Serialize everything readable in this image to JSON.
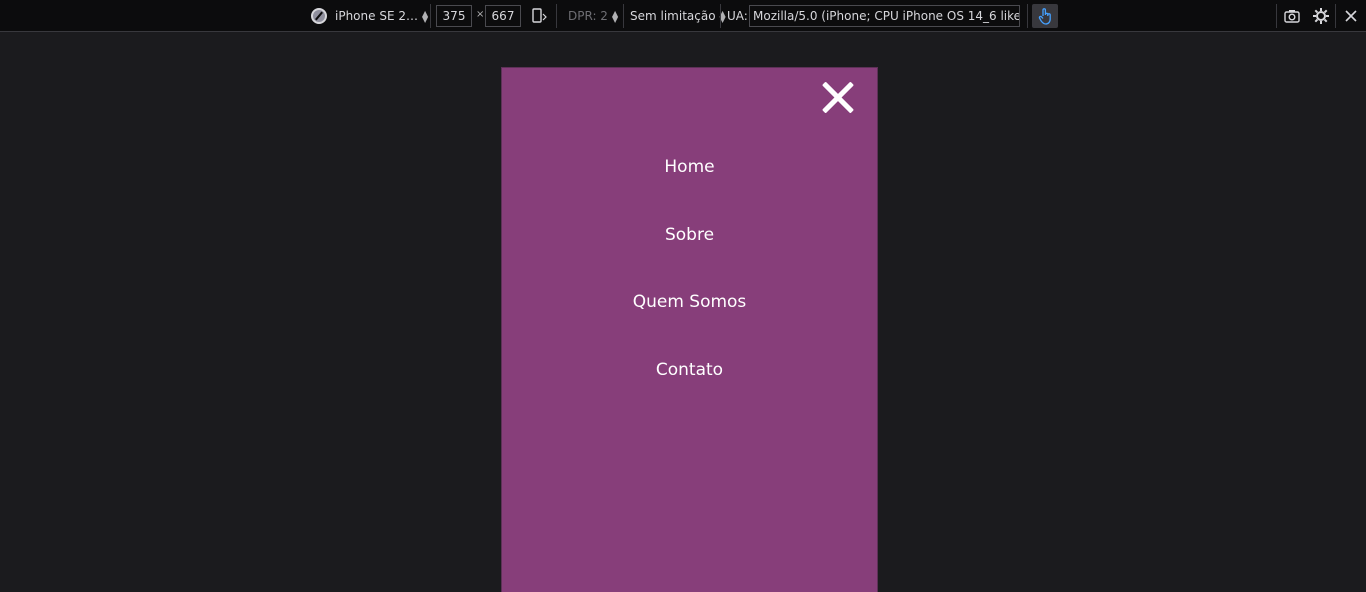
{
  "toolbar": {
    "device": "iPhone SE 2…",
    "width": "375",
    "times": "×",
    "height": "667",
    "dpr": "DPR: 2",
    "throttling": "Sem limitação",
    "ua_label": "UA:",
    "ua_value": "Mozilla/5.0 (iPhone; CPU iPhone OS 14_6 like Mac",
    "icons": [
      "device-icon",
      "rotate-icon",
      "touch-icon",
      "camera-icon",
      "gear-icon",
      "close-icon"
    ]
  },
  "viewport": {
    "background": "#873e7a",
    "menu": {
      "close_icon": "close-icon",
      "items": [
        {
          "label": "Home"
        },
        {
          "label": "Sobre"
        },
        {
          "label": "Quem Somos"
        },
        {
          "label": "Contato"
        }
      ]
    }
  }
}
